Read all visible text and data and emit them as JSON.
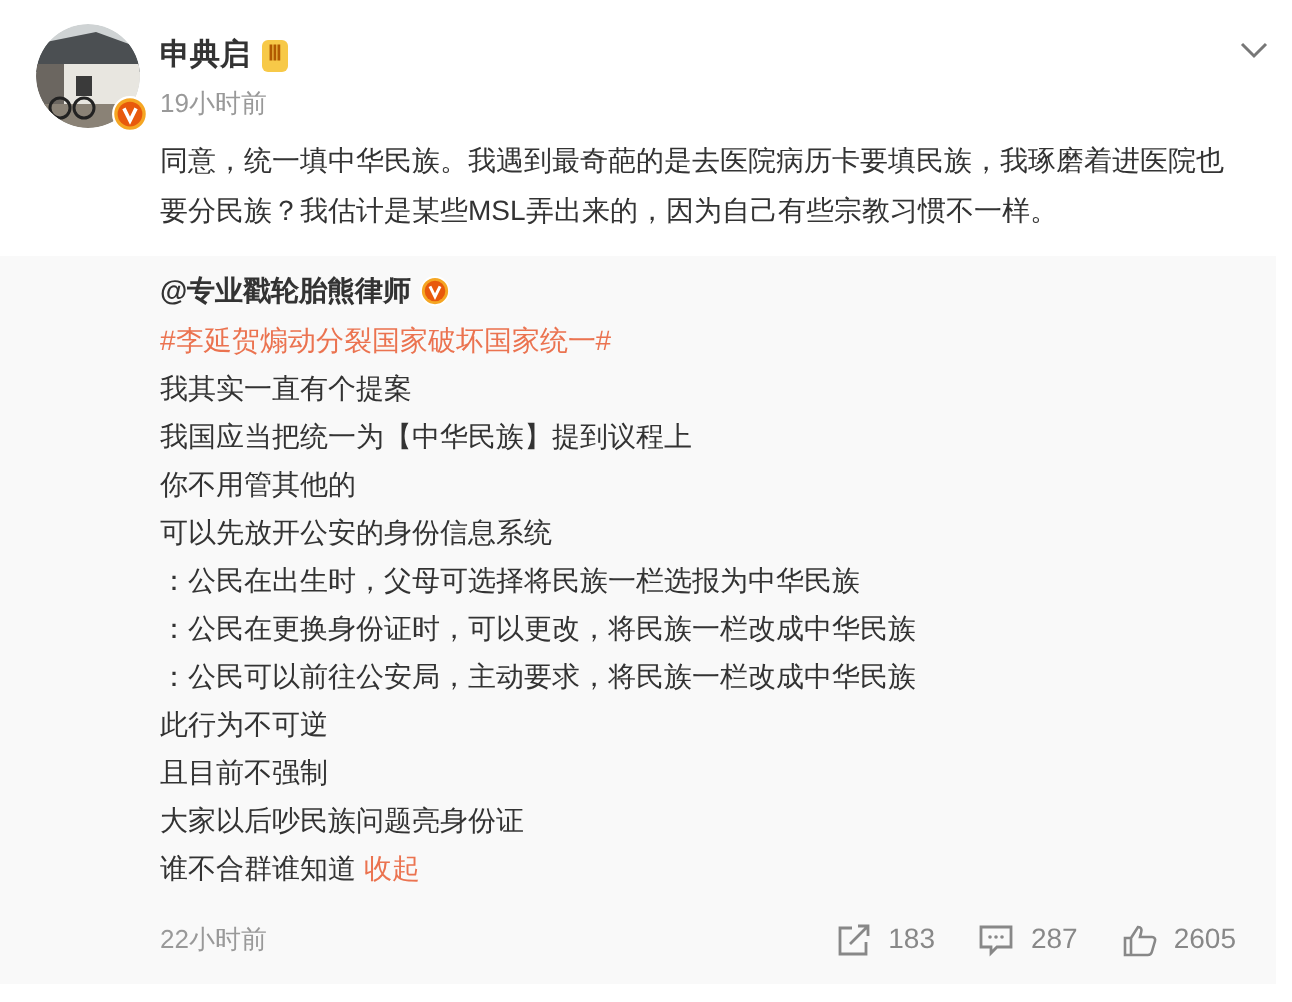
{
  "post": {
    "author": "申典启",
    "level_badge": "Ⅲ",
    "time": "19小时前",
    "text": "同意，统一填中华民族。我遇到最奇葩的是去医院病历卡要填民族，我琢磨着进医院也要分民族？我估计是某些MSL弄出来的，因为自己有些宗教习惯不一样。"
  },
  "repost": {
    "author": "@专业戳轮胎熊律师",
    "hashtag": "#李延贺煽动分裂国家破坏国家统一#",
    "lines": [
      "我其实一直有个提案",
      "我国应当把统一为【中华民族】提到议程上",
      "你不用管其他的",
      "可以先放开公安的身份信息系统",
      "：公民在出生时，父母可选择将民族一栏选报为中华民族",
      "：公民在更换身份证时，可以更改，将民族一栏改成中华民族",
      "：公民可以前往公安局，主动要求，将民族一栏改成中华民族",
      "此行为不可逆",
      "且目前不强制",
      "大家以后吵民族问题亮身份证",
      "谁不合群谁知道"
    ],
    "collapse_link": "收起",
    "time": "22小时前",
    "stats": [
      {
        "kind": "repost",
        "count": "183"
      },
      {
        "kind": "comment",
        "count": "287"
      },
      {
        "kind": "like",
        "count": "2605"
      }
    ]
  }
}
